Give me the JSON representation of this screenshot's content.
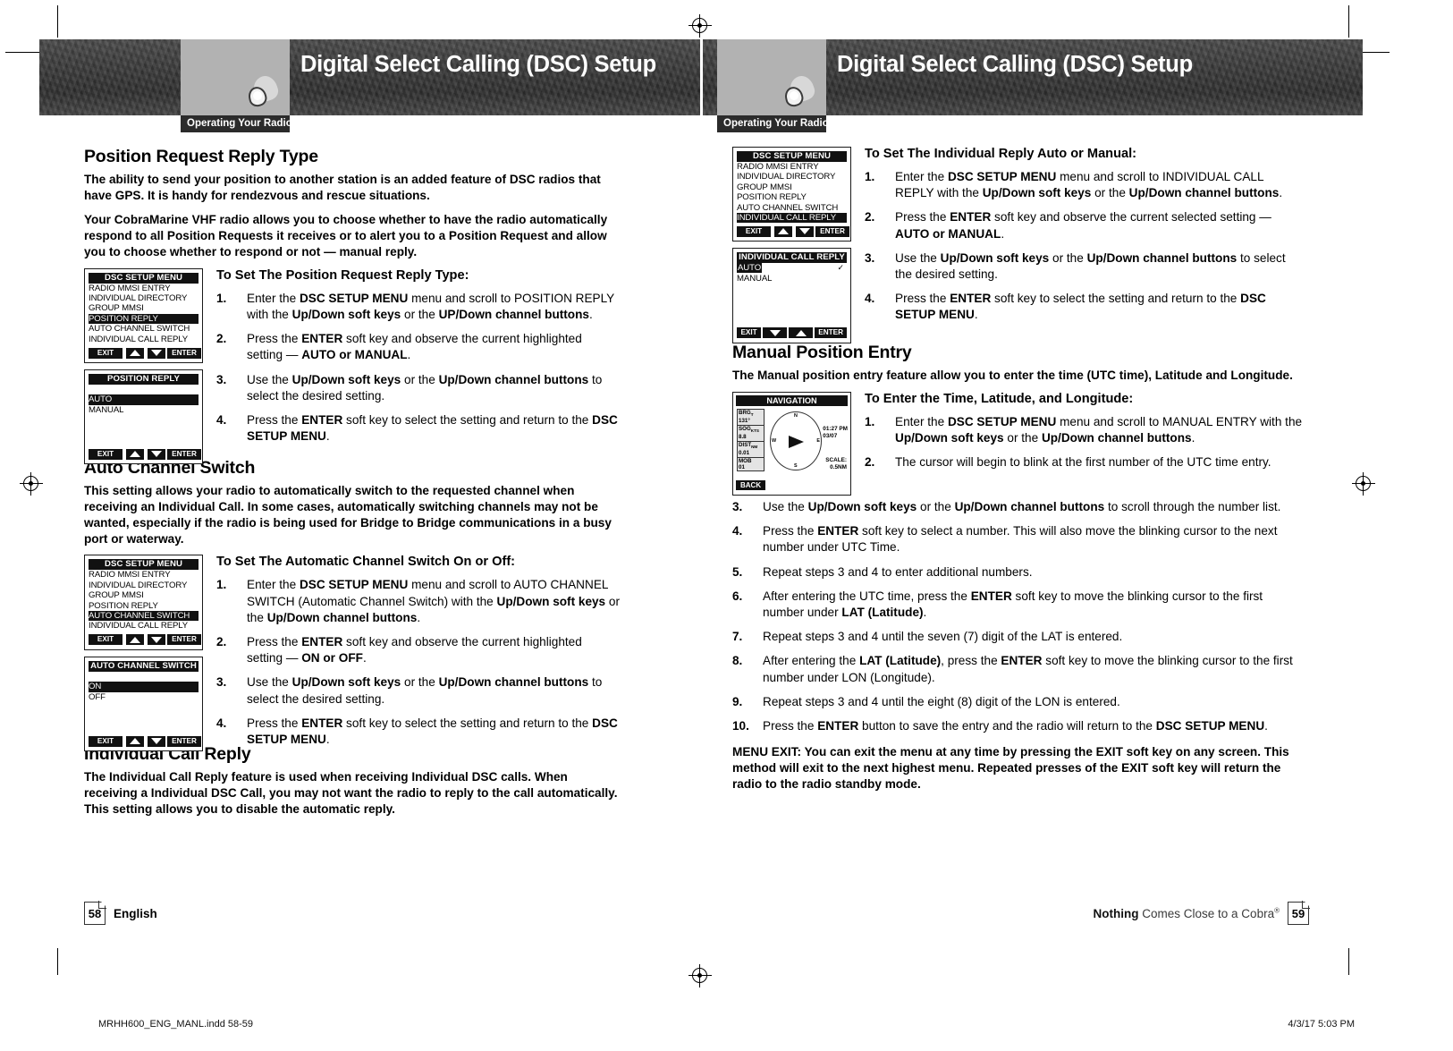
{
  "header": {
    "title": "Digital Select Calling (DSC) Setup",
    "breadcrumb": "Operating Your Radio"
  },
  "left_page": {
    "sections": [
      {
        "heading": "Position Request Reply Type",
        "paragraphs": [
          "The ability to send your position to another station is an added feature of DSC radios that have GPS. It is handy for rendezvous and rescue situations.",
          "Your CobraMarine VHF radio allows you to choose whether to have the radio automatically respond to all Position Requests it receives or to alert you to a Position Request and allow you to choose whether to respond or not — manual reply."
        ],
        "instruction_title": "To Set The Position Request Reply Type:",
        "steps": [
          {
            "num": "1.",
            "text": "Enter the DSC SETUP MENU menu and scroll to POSITION REPLY with the Up/Down soft keys or the UP/Down channel buttons."
          },
          {
            "num": "2.",
            "text": "Press the ENTER soft key and observe the current highlighted  setting — AUTO or MANUAL."
          },
          {
            "num": "3.",
            "text": "Use the Up/Down soft keys or the Up/Down channel buttons to select the desired setting."
          },
          {
            "num": "4.",
            "text": "Press the ENTER soft key to select the setting and return to the DSC SETUP MENU."
          }
        ]
      },
      {
        "heading": "Auto Channel Switch",
        "paragraphs": [
          "This setting allows your radio to automatically switch to the requested channel when receiving an Individual Call. In some cases, automatically switching channels may not be wanted, especially if the radio is being used for Bridge to Bridge communications in a busy port or waterway."
        ],
        "instruction_title": "To Set The Automatic Channel Switch On or Off:",
        "steps": [
          {
            "num": "1.",
            "text": "Enter the DSC SETUP MENU menu and scroll to AUTO CHANNEL SWITCH (Automatic Channel Switch) with the Up/Down soft keys or the Up/Down channel buttons."
          },
          {
            "num": "2.",
            "text": "Press the ENTER soft key and observe the current highlighted setting — ON or OFF."
          },
          {
            "num": "3.",
            "text": "Use the Up/Down soft keys or the Up/Down channel buttons to select the desired setting."
          },
          {
            "num": "4.",
            "text": "Press the ENTER soft key to select the setting and return to the DSC SETUP MENU."
          }
        ]
      },
      {
        "heading": "Individual Call Reply",
        "paragraphs": [
          "The Individual Call Reply feature is used when receiving Individual DSC calls. When receiving a Individual DSC Call, you may not want the radio to reply to the call automatically. This setting allows you to disable the automatic reply."
        ]
      }
    ],
    "lcds": [
      {
        "id": "dsc-setup-menu-position",
        "title": "DSC SETUP MENU",
        "rows": [
          {
            "label": "RADIO MMSI ENTRY",
            "highlighted": false
          },
          {
            "label": "INDIVIDUAL DIRECTORY",
            "highlighted": false
          },
          {
            "label": "GROUP MMSI",
            "highlighted": false
          },
          {
            "label": "POSITION REPLY",
            "highlighted": true
          },
          {
            "label": "AUTO CHANNEL SWITCH",
            "highlighted": false
          },
          {
            "label": "INDIVIDUAL CALL REPLY",
            "highlighted": false
          }
        ],
        "keys": [
          "EXIT",
          "up-arrow",
          "down-arrow",
          "ENTER"
        ]
      },
      {
        "id": "position-reply",
        "title": "POSITION REPLY",
        "rows": [
          {
            "label": "",
            "highlighted": false
          },
          {
            "label": "AUTO",
            "highlighted": true
          },
          {
            "label": "MANUAL",
            "highlighted": false
          },
          {
            "label": "",
            "highlighted": false
          },
          {
            "label": "",
            "highlighted": false
          },
          {
            "label": "",
            "highlighted": false
          }
        ],
        "keys": [
          "EXIT",
          "up-arrow",
          "down-arrow",
          "ENTER"
        ]
      },
      {
        "id": "dsc-setup-menu-auto-channel",
        "title": "DSC SETUP MENU",
        "rows": [
          {
            "label": "RADIO MMSI ENTRY",
            "highlighted": false
          },
          {
            "label": "INDIVIDUAL DIRECTORY",
            "highlighted": false
          },
          {
            "label": "GROUP MMSI",
            "highlighted": false
          },
          {
            "label": "POSITION REPLY",
            "highlighted": false
          },
          {
            "label": "AUTO CHANNEL SWITCH",
            "highlighted": true
          },
          {
            "label": "INDIVIDUAL CALL REPLY",
            "highlighted": false
          }
        ],
        "keys": [
          "EXIT",
          "up-arrow",
          "down-arrow",
          "ENTER"
        ]
      },
      {
        "id": "auto-channel-switch",
        "title": "AUTO CHANNEL SWITCH",
        "rows": [
          {
            "label": "",
            "highlighted": false
          },
          {
            "label": "ON",
            "highlighted": true
          },
          {
            "label": "OFF",
            "highlighted": false
          },
          {
            "label": "",
            "highlighted": false
          },
          {
            "label": "",
            "highlighted": false
          },
          {
            "label": "",
            "highlighted": false
          }
        ],
        "keys": [
          "EXIT",
          "up-arrow",
          "down-arrow",
          "ENTER"
        ]
      }
    ],
    "footer": {
      "page_number": "58",
      "language": "English"
    }
  },
  "right_page": {
    "sections": [
      {
        "instruction_title": "To Set The Individual Reply Auto or Manual:",
        "steps": [
          {
            "num": "1.",
            "text": "Enter the DSC SETUP MENU menu and scroll to INDIVIDUAL CALL REPLY with the Up/Down soft keys or the Up/Down channel buttons."
          },
          {
            "num": "2.",
            "text": "Press the ENTER soft key and observe the current selected setting — AUTO or MANUAL."
          },
          {
            "num": "3.",
            "text": "Use the Up/Down soft keys or the Up/Down channel buttons to select the desired setting."
          },
          {
            "num": "4.",
            "text": "Press the ENTER soft key to select the setting and return to the DSC SETUP MENU."
          }
        ]
      },
      {
        "heading": "Manual Position Entry",
        "paragraphs": [
          "The Manual position entry feature allow you to enter the time (UTC time), Latitude and Longitude."
        ],
        "instruction_title": "To Enter the Time, Latitude, and Longitude:",
        "steps_top": [
          {
            "num": "1.",
            "text": "Enter the DSC SETUP MENU menu and scroll to MANUAL ENTRY with the Up/Down soft keys or the Up/Down channel buttons."
          },
          {
            "num": "2.",
            "text": "The cursor will begin to blink at the first number of the UTC time entry."
          }
        ],
        "steps_rest": [
          {
            "num": "3.",
            "text": "Use the Up/Down soft keys or the Up/Down channel buttons to scroll through the number list."
          },
          {
            "num": "4.",
            "text": "Press the ENTER soft key to select a number. This will also move the blinking cursor to the next number under UTC Time."
          },
          {
            "num": "5.",
            "text": "Repeat steps 3 and 4 to enter additional numbers."
          },
          {
            "num": "6.",
            "text": "After entering the UTC time, press the ENTER soft key to move the blinking cursor to the first number under LAT (Latitude)."
          },
          {
            "num": "7.",
            "text": "Repeat steps 3 and 4 until the seven (7) digit of the LAT is entered."
          },
          {
            "num": "8.",
            "text": "After entering the LAT (Latitude), press the ENTER soft key to move the blinking cursor to the first number under LON (Longitude)."
          },
          {
            "num": "9.",
            "text": "Repeat steps 3 and 4 until the eight (8) digit of the LON is entered."
          },
          {
            "num": "10.",
            "text": "Press the ENTER button to save the entry and the radio will return to the DSC SETUP MENU."
          }
        ],
        "menu_exit_note": "MENU EXIT: You can exit the menu at any time by pressing the EXIT soft key on any screen. This method will exit to the next highest menu. Repeated presses of the EXIT soft key will return the radio to the radio standby mode."
      }
    ],
    "lcds": [
      {
        "id": "dsc-setup-menu-individual",
        "title": "DSC SETUP MENU",
        "rows": [
          {
            "label": "RADIO MMSI ENTRY",
            "highlighted": false
          },
          {
            "label": "INDIVIDUAL DIRECTORY",
            "highlighted": false
          },
          {
            "label": "GROUP MMSI",
            "highlighted": false
          },
          {
            "label": "POSITION REPLY",
            "highlighted": false
          },
          {
            "label": "AUTO CHANNEL SWITCH",
            "highlighted": false
          },
          {
            "label": "INDIVIDUAL CALL REPLY",
            "highlighted": true
          }
        ],
        "keys": [
          "EXIT",
          "up-arrow",
          "down-arrow",
          "ENTER"
        ]
      },
      {
        "id": "individual-call-reply",
        "title": "INDIVIDUAL CALL REPLY",
        "rows": [
          {
            "label": "AUTO",
            "highlighted": true,
            "check": "✓"
          },
          {
            "label": "MANUAL",
            "highlighted": false
          },
          {
            "label": "",
            "highlighted": false
          },
          {
            "label": "",
            "highlighted": false
          },
          {
            "label": "",
            "highlighted": false
          },
          {
            "label": "",
            "highlighted": false
          }
        ],
        "keys": [
          "EXIT",
          "down-arrow",
          "up-arrow",
          "ENTER"
        ]
      }
    ],
    "nav_lcd": {
      "title": "NAVIGATION",
      "fields": [
        {
          "label": "BRG",
          "unit": "T",
          "value": "131°"
        },
        {
          "label": "SOG",
          "unit": "KTS",
          "value": "8.8"
        },
        {
          "label": "DIST",
          "unit": "NM",
          "value": "0.01"
        },
        {
          "label": "MOB",
          "unit": "",
          "value": "01"
        }
      ],
      "compass": {
        "n": "N",
        "s": "S",
        "e": "E",
        "w": "W"
      },
      "time": "01:27  PM",
      "date": "03/07",
      "scale_label": "SCALE:",
      "scale_value": "0.5NM",
      "back_key": "BACK"
    },
    "footer": {
      "page_number": "59",
      "tagline_bold": "Nothing",
      "tagline_rest": " Comes Close to a Cobra",
      "tagline_sup": "®"
    }
  },
  "print_slug": {
    "left": "MRHH600_ENG_MANL.indd   58-59",
    "right": "4/3/17   5:03 PM"
  }
}
